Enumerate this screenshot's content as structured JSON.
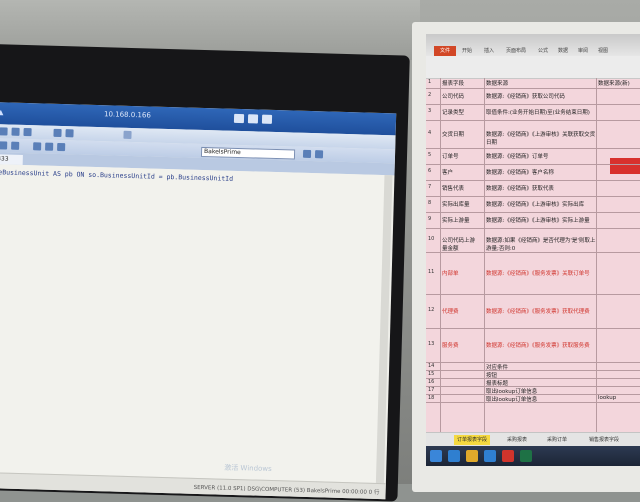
{
  "laptop": {
    "rdp_host": "10.168.0.166",
    "database": "BakelsPrime",
    "tab_label": "B33",
    "sql_line": "geBusinessUnit AS pb ON so.BusinessUnitId = pb.BusinessUnitId",
    "watermark": "激活 Windows",
    "status_text": "SERVER (11.0 SP1)   DSG\\COMPUTER (53)   BakelsPrime   00:00:00   0 行"
  },
  "spreadsheet": {
    "file_tab": "文件",
    "ribbon_tabs": [
      "开始",
      "插入",
      "页面布局",
      "公式",
      "数据",
      "审阅",
      "视图"
    ],
    "rows": [
      {
        "n": "1",
        "a": "报表字段",
        "b": "数据来源",
        "c": "数据来源(新)",
        "red": false
      },
      {
        "n": "2",
        "a": "公司代码",
        "b": "数据源:《经销商》获取公司代码",
        "c": "",
        "red": false
      },
      {
        "n": "3",
        "a": "记录类型",
        "b": "取值条件:(业务开始日期)至(业务结束日期)",
        "c": "",
        "red": false
      },
      {
        "n": "4",
        "a": "交货日期",
        "b": "数据源:《经销商》《上游审核》关联获取交货日期",
        "c": "",
        "red": false
      },
      {
        "n": "5",
        "a": "订单号",
        "b": "数据源:《经销商》订单号",
        "c": "",
        "red": false
      },
      {
        "n": "6",
        "a": "客户",
        "b": "数据源:《经销商》客户名称",
        "c": "",
        "red": false
      },
      {
        "n": "7",
        "a": "销售代表",
        "b": "数据源:《经销商》获取代表",
        "c": "",
        "red": false
      },
      {
        "n": "8",
        "a": "实际出库量",
        "b": "数据源:《经销商》《上游审核》实际出库",
        "c": "",
        "red": false
      },
      {
        "n": "9",
        "a": "实际上游量",
        "b": "数据源:《经销商》《上游审核》实际上游量",
        "c": "",
        "red": false
      },
      {
        "n": "10",
        "a": "公司代码上游量金额",
        "b": "数据源:如果《经销商》是否代理为'是'则取上游量;否则:0",
        "c": "",
        "red": false
      },
      {
        "n": "11",
        "a": "内部单",
        "b": "数据源:《经销商》《服务发票》关联订单号",
        "c": "",
        "red": true
      },
      {
        "n": "12",
        "a": "代理费",
        "b": "数据源:《经销商》《服务发票》获取代理费",
        "c": "",
        "red": true
      },
      {
        "n": "13",
        "a": "服务费",
        "b": "数据源:《经销商》《服务发票》获取服务费",
        "c": "",
        "red": true
      },
      {
        "n": "14",
        "a": "",
        "b": "对应条件",
        "c": "",
        "red": false
      },
      {
        "n": "15",
        "a": "",
        "b": "按钮",
        "c": "",
        "red": false
      },
      {
        "n": "16",
        "a": "",
        "b": "报表标题",
        "c": "",
        "red": false
      },
      {
        "n": "17",
        "a": "",
        "b": "取出lookup订单信息",
        "c": "",
        "red": false
      },
      {
        "n": "18",
        "a": "",
        "b": "取出lookup订单信息",
        "c": "lookup",
        "red": false
      }
    ],
    "sheet_tabs": [
      "订单报表字段",
      "采购报表",
      "采购订单",
      "销售报表字段"
    ],
    "accent_red": "#d0342c",
    "sheet_bg": "#f3d6dc"
  }
}
